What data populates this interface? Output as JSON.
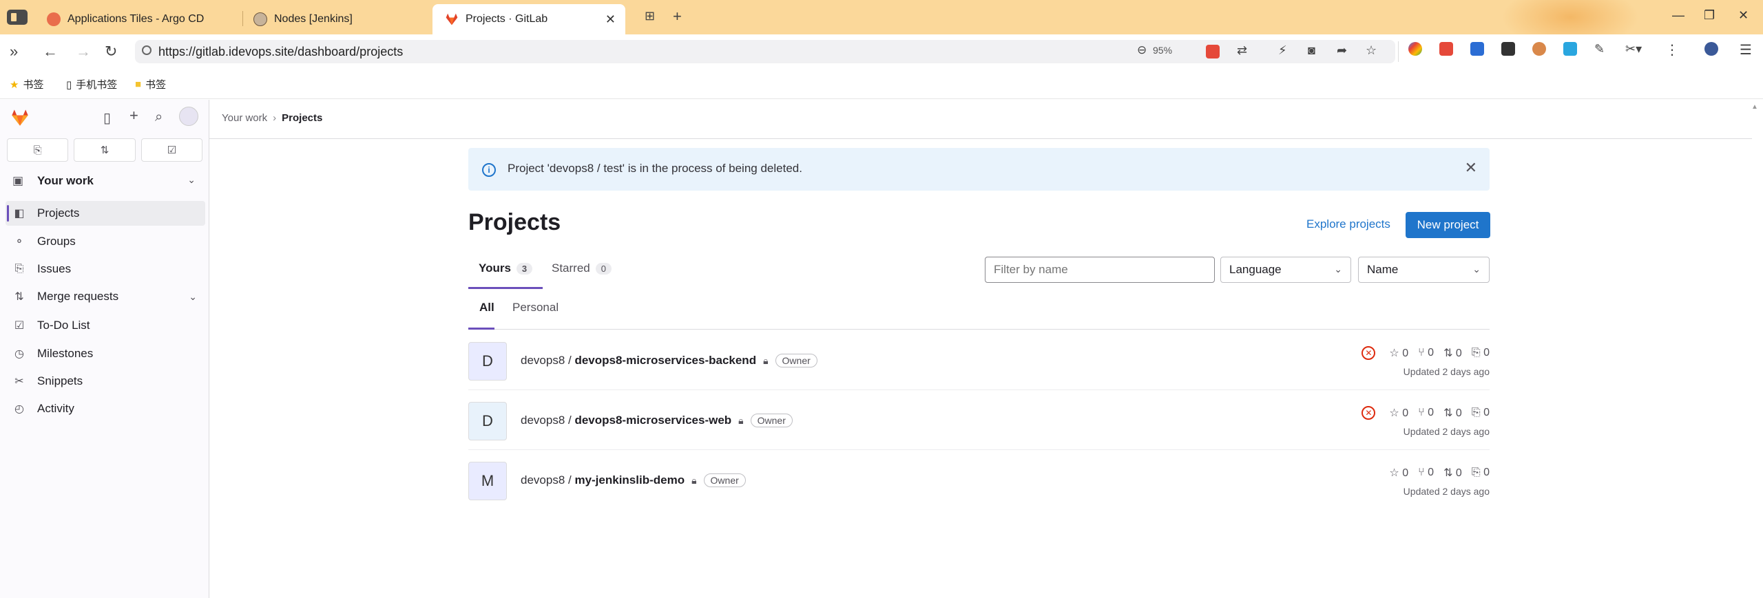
{
  "browser": {
    "tabs": [
      {
        "title": "Applications Tiles - Argo CD"
      },
      {
        "title": "Nodes [Jenkins]"
      },
      {
        "title": "Projects · GitLab"
      }
    ],
    "url": "https://gitlab.idevops.site/dashboard/projects",
    "zoom": "95%",
    "bookmarks": [
      "书签",
      "手机书签",
      "书签"
    ]
  },
  "breadcrumb": {
    "parent": "Your work",
    "current": "Projects"
  },
  "sidebar": {
    "section": "Your work",
    "items": [
      {
        "label": "Projects",
        "icon": "project-icon",
        "active": true
      },
      {
        "label": "Groups",
        "icon": "group-icon"
      },
      {
        "label": "Issues",
        "icon": "issues-icon"
      },
      {
        "label": "Merge requests",
        "icon": "merge-request-icon"
      },
      {
        "label": "To-Do List",
        "icon": "todo-icon"
      },
      {
        "label": "Milestones",
        "icon": "milestone-icon"
      },
      {
        "label": "Snippets",
        "icon": "snippet-icon"
      },
      {
        "label": "Activity",
        "icon": "activity-icon"
      }
    ]
  },
  "alert": {
    "message": "Project 'devops8 / test' is in the process of being deleted."
  },
  "page": {
    "title": "Projects",
    "explore_label": "Explore projects",
    "new_project_label": "New project"
  },
  "tabs": [
    {
      "label": "Yours",
      "count": "3"
    },
    {
      "label": "Starred",
      "count": "0"
    }
  ],
  "filters": {
    "placeholder": "Filter by name",
    "language": "Language",
    "sort": "Name"
  },
  "subtabs": [
    "All",
    "Personal"
  ],
  "projects": [
    {
      "avatar": "D",
      "namespace": "devops8 / ",
      "name": "devops8-microservices-backend",
      "badge": "Owner",
      "pipeline_failed": true,
      "stars": "0",
      "forks": "0",
      "mrs": "0",
      "issues": "0",
      "updated": "Updated 2 days ago"
    },
    {
      "avatar": "D",
      "namespace": "devops8 / ",
      "name": "devops8-microservices-web",
      "badge": "Owner",
      "pipeline_failed": true,
      "stars": "0",
      "forks": "0",
      "mrs": "0",
      "issues": "0",
      "updated": "Updated 2 days ago"
    },
    {
      "avatar": "M",
      "namespace": "devops8 / ",
      "name": "my-jenkinslib-demo",
      "badge": "Owner",
      "pipeline_failed": false,
      "stars": "0",
      "forks": "0",
      "mrs": "0",
      "issues": "0",
      "updated": "Updated 2 days ago"
    }
  ],
  "colors": {
    "accent": "#1f75cb",
    "active_tab": "#6b4fbb",
    "danger": "#dd2b0e"
  }
}
